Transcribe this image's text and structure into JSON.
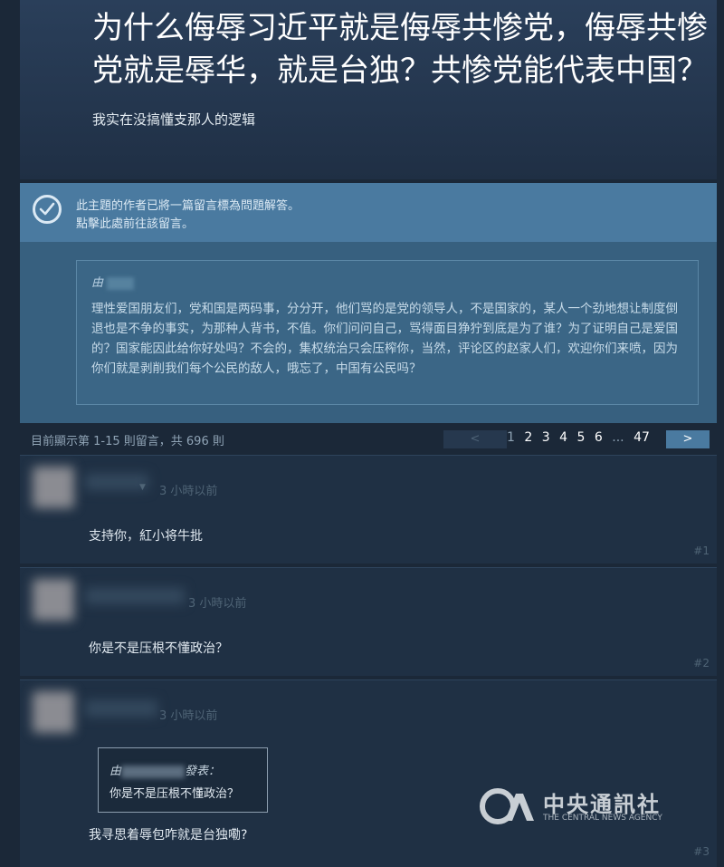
{
  "topic": {
    "title": "为什么侮辱习近平就是侮辱共惨党，侮辱共惨党就是辱华，就是台独？共惨党能代表中国？",
    "subtitle": "我实在没搞懂支那人的逻辑"
  },
  "answer_banner": {
    "line1": "此主題的作者已將一篇留言標為問題解答。",
    "line2": "點擊此處前往該留言。"
  },
  "answer_quote": {
    "from_label": "由",
    "text": "理性爱国朋友们，党和国是两码事，分分开，他们骂的是党的领导人，不是国家的，某人一个劲地想让制度倒退也是不争的事实，为那种人背书，不值。你们问问自己，骂得面目狰狞到底是为了谁？为了证明自己是爱国的？国家能因此给你好处吗？不会的，集权统治只会压榨你，当然，评论区的赵家人们，欢迎你们来喷，因为你们就是剥削我们每个公民的敌人，哦忘了，中国有公民吗？"
  },
  "pager": {
    "info": "目前顯示第 1-15 則留言，共 696 則",
    "prev": "<",
    "pages": [
      "1",
      "2",
      "3",
      "4",
      "5",
      "6"
    ],
    "ellipsis": "...",
    "last": "47",
    "next": ">"
  },
  "comments": [
    {
      "time": "3 小時以前",
      "text": "支持你，紅小将牛批",
      "num": "#1"
    },
    {
      "time": "3 小時以前",
      "text": "你是不是压根不懂政治？",
      "num": "#2"
    },
    {
      "time": "3 小時以前",
      "quote_from": "由",
      "quote_suffix": "發表：",
      "quote_text": "你是不是压根不懂政治？",
      "text": "我寻思着辱包咋就是台独嘞?",
      "num": "#3"
    }
  ],
  "watermark": {
    "title": "中央通訊社",
    "subtitle": "THE CENTRAL NEWS AGENCY"
  }
}
